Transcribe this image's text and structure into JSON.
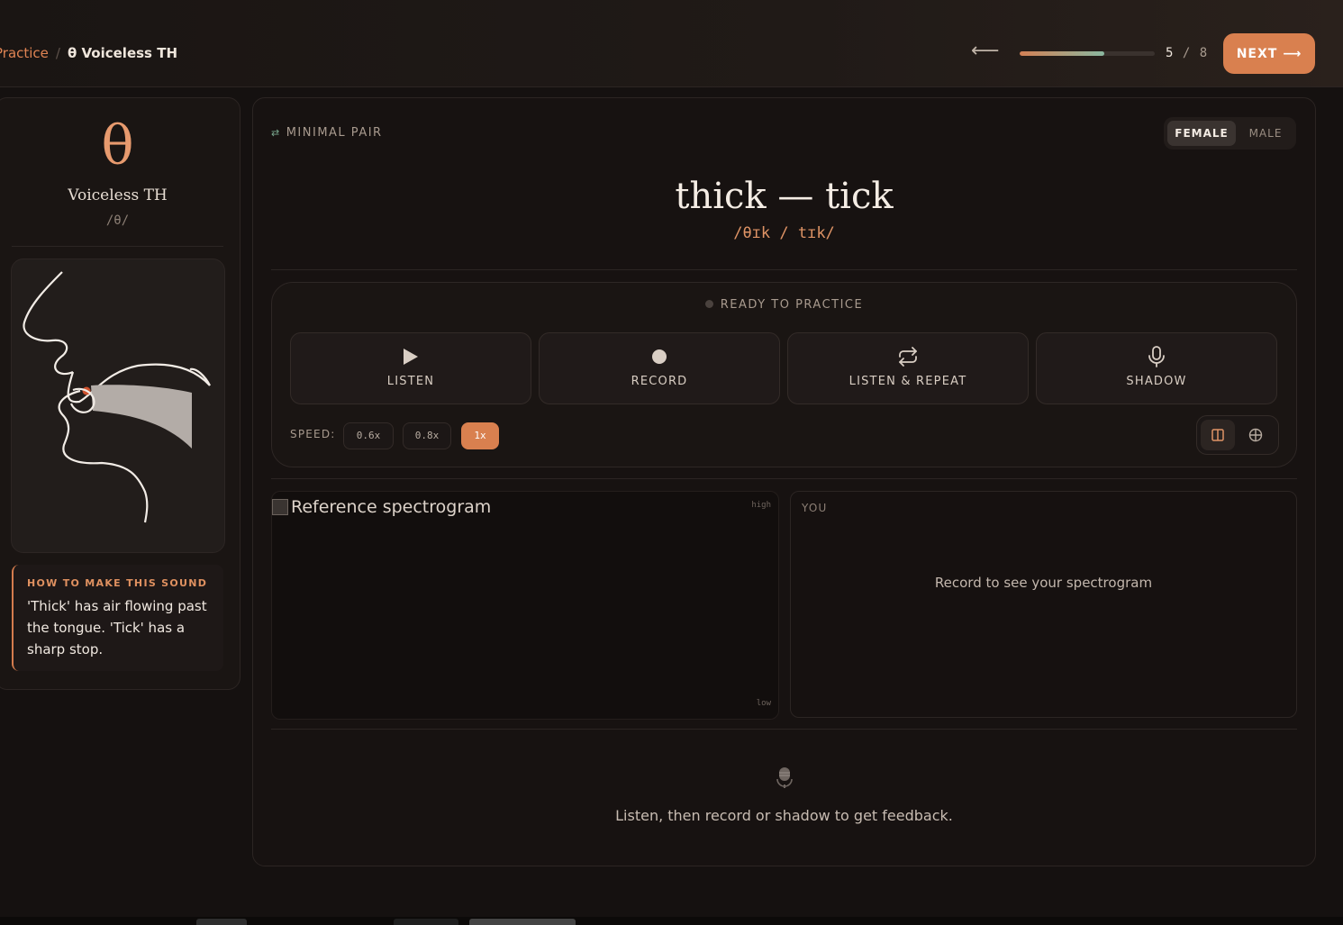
{
  "breadcrumb": {
    "parent": "Practice",
    "separator": "/",
    "current": "θ Voiceless TH"
  },
  "progress": {
    "back_icon": "arrow-left-icon",
    "current": "5",
    "separator": "/",
    "total": "8",
    "fraction": 0.625,
    "next_label": "NEXT ⟶"
  },
  "sound": {
    "symbol": "θ",
    "name": "Voiceless TH",
    "ipa": "/θ/",
    "diagram_icon": "mouth-sagittal-diagram",
    "howto_title": "HOW TO MAKE THIS SOUND",
    "howto_text": "'Thick' has air flowing past the tongue. 'Tick' has a sharp stop."
  },
  "exercise": {
    "type_icon": "swap-arrows-icon",
    "type_label": "MINIMAL PAIR",
    "voices": [
      "FEMALE",
      "MALE"
    ],
    "selected_voice": "FEMALE",
    "word": "thick — tick",
    "ipa": "/θɪk / tɪk/"
  },
  "practice": {
    "status": "READY TO PRACTICE",
    "modes": [
      {
        "label": "LISTEN",
        "icon": "play-icon"
      },
      {
        "label": "RECORD",
        "icon": "record-dot-icon"
      },
      {
        "label": "LISTEN & REPEAT",
        "icon": "repeat-icon"
      },
      {
        "label": "SHADOW",
        "icon": "microphone-icon"
      }
    ],
    "speed_label": "SPEED:",
    "speeds": [
      "0.6x",
      "0.8x",
      "1x"
    ],
    "selected_speed": "1x",
    "view_options": [
      "split-view-icon",
      "overlay-view-icon"
    ]
  },
  "spectrogram": {
    "reference_alt": "Reference spectrogram",
    "high_label": "high",
    "low_label": "low",
    "you_label": "YOU",
    "you_empty": "Record to see your spectrogram"
  },
  "feedback": {
    "icon": "microphone-icon",
    "text": "Listen, then record or shadow to get feedback."
  },
  "colors": {
    "accent": "#d9804f",
    "teal": "#8ab8a0",
    "background": "#151110"
  }
}
